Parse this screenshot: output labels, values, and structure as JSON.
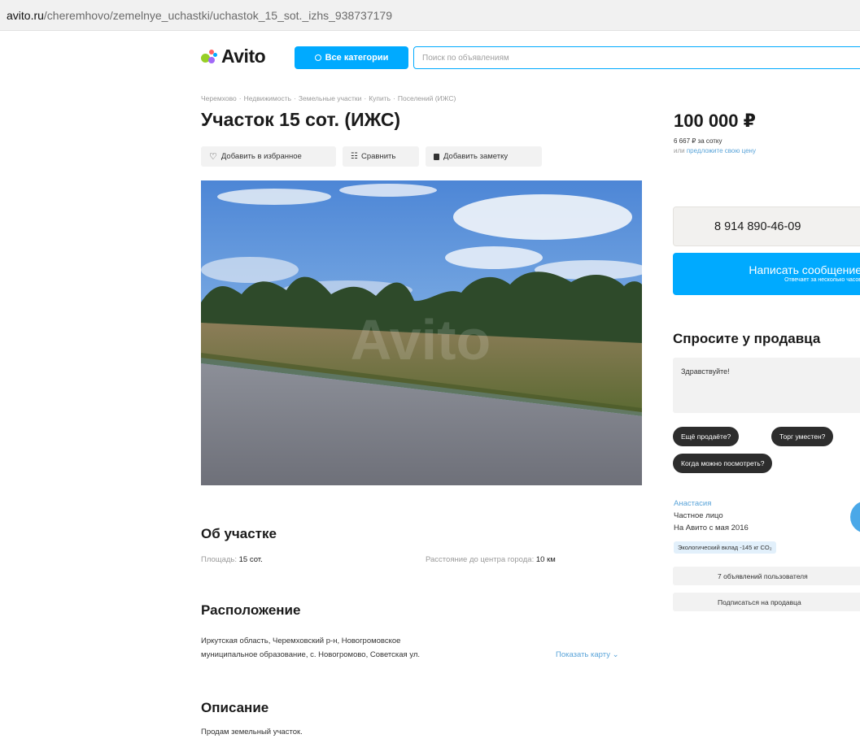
{
  "browser": {
    "url_host": "avito.ru",
    "url_path": "/cheremhovo/zemelnye_uchastki/uchastok_15_sot._izhs_938737179"
  },
  "header": {
    "logo_text": "Avito",
    "categories_button": "Все категории",
    "search_placeholder": "Поиск по объявлениям",
    "brand_colors": [
      "#97cf26",
      "#a169f7",
      "#ff6163",
      "#00aaff"
    ]
  },
  "breadcrumbs": [
    "Черемхово",
    "Недвижимость",
    "Земельные участки",
    "Купить",
    "Поселений (ИЖС)"
  ],
  "listing": {
    "title": "Участок 15 сот. (ИЖС)",
    "actions": {
      "favorite": "Добавить в избранное",
      "compare": "Сравнить",
      "note": "Добавить заметку"
    },
    "photo_watermark": "Avito"
  },
  "about": {
    "title": "Об участке",
    "area_label": "Площадь:",
    "area_value": "15 сот.",
    "distance_label": "Расстояние до центра города:",
    "distance_value": "10 км"
  },
  "location": {
    "title": "Расположение",
    "address_line1": "Иркутская область, Черемховский р-н, Новогромовское",
    "address_line2": "муниципальное образование, с. Новогромово, Советская ул.",
    "map_link": "Показать карту"
  },
  "description": {
    "title": "Описание",
    "text": "Продам земельный участок."
  },
  "sidebar": {
    "price": "100 000 ₽",
    "price_per_unit": "6 667 ₽ за сотку",
    "offer_prefix": "или",
    "offer_link": "предложите свою цену",
    "phone": "8 914 890-46-09",
    "message_button": "Написать сообщение",
    "message_sub": "Отвечает за несколько часов",
    "ask_title": "Спросите у продавца",
    "ask_input_value": "Здравствуйте!",
    "chips": [
      "Ещё продаёте?",
      "Торг уместен?",
      "Когда можно посмотреть?"
    ],
    "seller_name": "Анастасия",
    "seller_type": "Частное лицо",
    "seller_since": "На Авито с мая 2016",
    "eco_badge": "Экологический вклад -145 кг CO₂",
    "user_listings": "7 объявлений пользователя",
    "subscribe": "Подписаться на продавца"
  }
}
